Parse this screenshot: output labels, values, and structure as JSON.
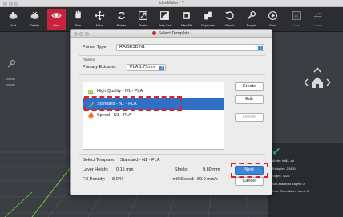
{
  "app": {
    "title": "ideaMaker - *"
  },
  "toolbar": {
    "items": [
      {
        "label": "Add",
        "icon": "add-icon",
        "active": false
      },
      {
        "label": "Delete",
        "icon": "delete-icon",
        "active": false
      },
      {
        "label": "View",
        "icon": "eye-icon",
        "active": true
      },
      {
        "label": "Pan",
        "icon": "hand-icon",
        "active": false
      },
      {
        "label": "Move",
        "icon": "move-icon",
        "active": false
      },
      {
        "label": "Rotate",
        "icon": "rotate-icon",
        "active": false
      },
      {
        "label": "Scale",
        "icon": "scale-icon",
        "active": false
      },
      {
        "label": "Free Cut",
        "icon": "cut-icon",
        "active": false
      },
      {
        "label": "Max Fit",
        "icon": "max-fit-icon",
        "active": false
      },
      {
        "label": "Duplicate",
        "icon": "duplicate-icon",
        "active": false
      },
      {
        "label": "Reset",
        "icon": "reset-icon",
        "active": false
      },
      {
        "label": "Repair",
        "icon": "repair-icon",
        "active": false
      },
      {
        "label": "Start",
        "icon": "start-icon",
        "active": false
      },
      {
        "label": "Snap",
        "icon": "snap-icon",
        "active": false
      },
      {
        "label": "Layers",
        "icon": "layers-icon",
        "active": false
      }
    ]
  },
  "dialog": {
    "title": "Select Template",
    "printer_type_label": "Printer Type:",
    "printer_type_value": "RAISE3D N1",
    "filament_label": "Filament",
    "primary_extruder_label": "Primary Extruder:",
    "primary_extruder_value": "PLA 1.75mm",
    "templates": [
      {
        "name": "High Quality - N1 - PLA",
        "icon": "snail-icon",
        "selected": false
      },
      {
        "name": "Standard - N1 - PLA",
        "icon": "rabbit-icon",
        "selected": true
      },
      {
        "name": "Speed - N1 - PLA",
        "icon": "flame-icon",
        "selected": false
      }
    ],
    "buttons": {
      "create": "Create",
      "edit": "Edit",
      "delete": "Delete",
      "next": "Next",
      "cancel": "Cancel"
    },
    "summary": {
      "selected_template_label": "Select Template:",
      "selected_template_value": "Standard - N1 - PLA",
      "layer_height_label": "Layer Height:",
      "layer_height_value": "0.15 mm",
      "shells_label": "Shells:",
      "shells_value": "0.80 mm",
      "fill_density_label": "Fill Density:",
      "fill_density_value": "8.0 %",
      "infill_speed_label": "Infill Speed:",
      "infill_speed_value": "80.0 mm/s"
    }
  },
  "info_panel": {
    "rows": [
      "Model: ball-1.stl",
      "Triangles: 28426",
      "Edges: 4228",
      "Non-Manifold Edges: 0",
      "Error Orientation Faces: 0"
    ]
  },
  "colors": {
    "accent": "#3b86d8",
    "selection": "#2f6fc4",
    "active_tool": "#c8233a",
    "highlight_box": "#e0202a",
    "ok_check": "#1fb26b"
  }
}
